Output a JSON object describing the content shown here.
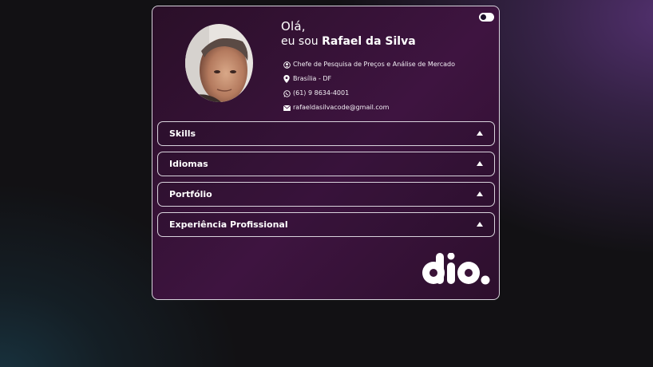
{
  "profile": {
    "greeting": "Olá,",
    "intro": "eu sou",
    "name": "Rafael da Silva",
    "job_title": "Chefe de Pesquisa de Preços e Análise de Mercado",
    "location": "Brasília - DF",
    "phone": "(61) 9 8634-4001",
    "email": "rafaeldasilvacode@gmail.com"
  },
  "accordion": [
    {
      "label": "Skills"
    },
    {
      "label": "Idiomas"
    },
    {
      "label": "Portfólio"
    },
    {
      "label": "Experiência Profissional"
    }
  ],
  "icons": {
    "theme_toggle": "toggle-icon",
    "job": "user-circle-icon",
    "location": "map-pin-icon",
    "phone": "whatsapp-icon",
    "email": "envelope-icon",
    "expand": "triangle-up-icon",
    "brand": "dio-logo"
  },
  "brand_logo_text": "dio.",
  "colors": {
    "background": "#121114",
    "card": "#3e1440",
    "accent_purple": "#52306e",
    "text": "#ffffff",
    "border": "#d7d2dc"
  }
}
